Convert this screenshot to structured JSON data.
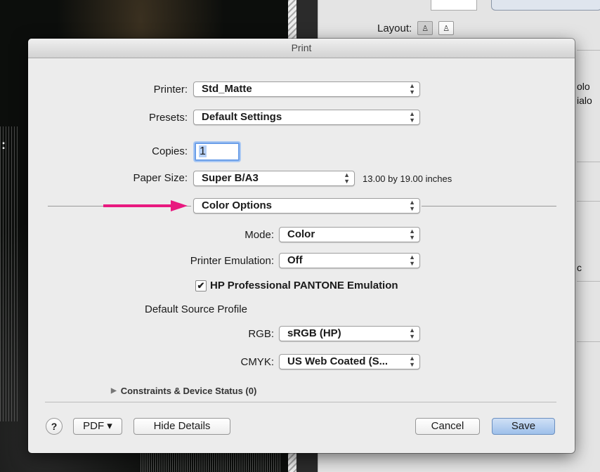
{
  "background": {
    "right_panel": {
      "layout_label": "Layout:",
      "side_texts": [
        "olo",
        "ialo",
        "c"
      ]
    },
    "left_mark": ":"
  },
  "dialog": {
    "title": "Print",
    "printer": {
      "label": "Printer:",
      "value": "Std_Matte"
    },
    "presets": {
      "label": "Presets:",
      "value": "Default Settings"
    },
    "copies": {
      "label": "Copies:",
      "value": "1"
    },
    "paper_size": {
      "label": "Paper Size:",
      "value": "Super B/A3",
      "info": "13.00 by 19.00 inches"
    },
    "section_popup": {
      "value": "Color Options"
    },
    "mode": {
      "label": "Mode:",
      "value": "Color"
    },
    "printer_emulation": {
      "label": "Printer Emulation:",
      "value": "Off"
    },
    "pantone_checkbox": {
      "label": "HP Professional PANTONE Emulation",
      "checked": true
    },
    "default_source_profile_label": "Default Source Profile",
    "rgb": {
      "label": "RGB:",
      "value": "sRGB (HP)"
    },
    "cmyk": {
      "label": "CMYK:",
      "value": "US Web Coated (S..."
    },
    "constraints": {
      "label": "Constraints & Device Status (0)"
    },
    "buttons": {
      "help": "?",
      "pdf": "PDF ▾",
      "hide_details": "Hide Details",
      "cancel": "Cancel",
      "save": "Save"
    }
  },
  "colors": {
    "arrow": "#e8197f",
    "focus_ring": "#6b9ee8",
    "default_button": "#9ec0ea"
  }
}
